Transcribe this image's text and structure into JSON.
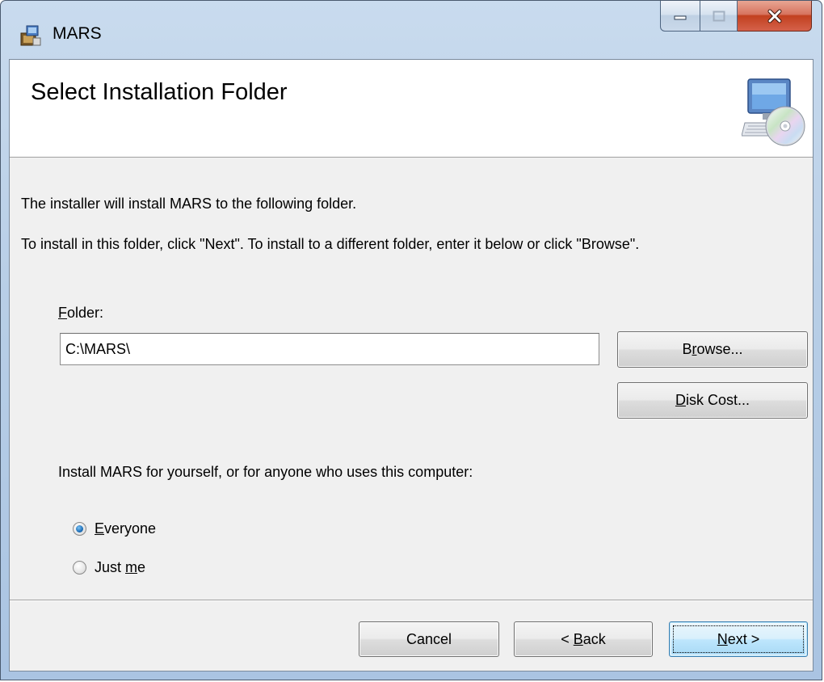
{
  "window": {
    "title": "MARS"
  },
  "banner": {
    "title": "Select Installation Folder",
    "icon": "computer-cd-icon"
  },
  "body": {
    "intro": "The installer will install MARS to the following folder.",
    "instructions": "To install in this folder, click \"Next\". To install to a different folder, enter it below or click \"Browse\"."
  },
  "folder": {
    "label_accel": "F",
    "label_rest": "older:",
    "value": "C:\\MARS\\"
  },
  "buttons": {
    "browse_pre": "B",
    "browse_accel": "r",
    "browse_post": "owse...",
    "disk_accel": "D",
    "disk_post": "isk Cost...",
    "cancel": "Cancel",
    "back_pre": "< ",
    "back_accel": "B",
    "back_post": "ack",
    "next_accel": "N",
    "next_post": "ext >"
  },
  "install_for": {
    "prompt": "Install MARS for yourself, or for anyone who uses this computer:",
    "options": [
      {
        "accel": "E",
        "rest": "veryone",
        "pre": "",
        "checked": true
      },
      {
        "pre": "Just ",
        "accel": "m",
        "rest": "e",
        "checked": false
      }
    ]
  }
}
